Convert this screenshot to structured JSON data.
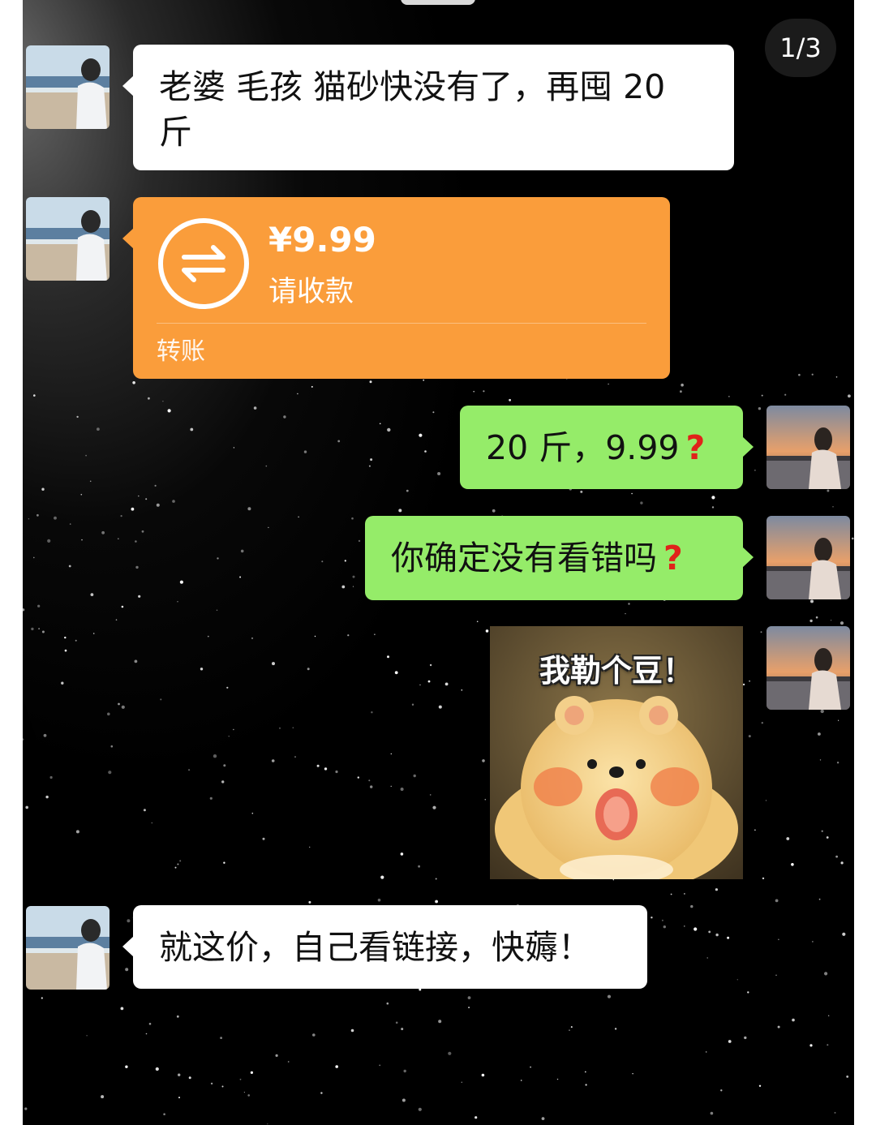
{
  "page_indicator": "1/3",
  "messages": [
    {
      "side": "left",
      "type": "text",
      "text": "老婆 毛孩 猫砂快没有了，再囤 20 斤"
    },
    {
      "side": "left",
      "type": "transfer",
      "amount": "¥9.99",
      "description": "请收款",
      "label": "转账",
      "icon": "transfer-arrows-icon"
    },
    {
      "side": "right",
      "type": "text",
      "text": "20 斤，9.99",
      "suffix": "?"
    },
    {
      "side": "right",
      "type": "text",
      "text": "你确定没有看错吗",
      "suffix": "?"
    },
    {
      "side": "right",
      "type": "sticker",
      "caption": "我勒个豆！"
    },
    {
      "side": "left",
      "type": "text",
      "text": "就这价，自己看链接，快薅！"
    }
  ],
  "colors": {
    "background": "#000000",
    "incoming_bubble": "#ffffff",
    "outgoing_bubble": "#95ec69",
    "transfer": "#fa9d3b",
    "question_mark": "#e0231a"
  }
}
